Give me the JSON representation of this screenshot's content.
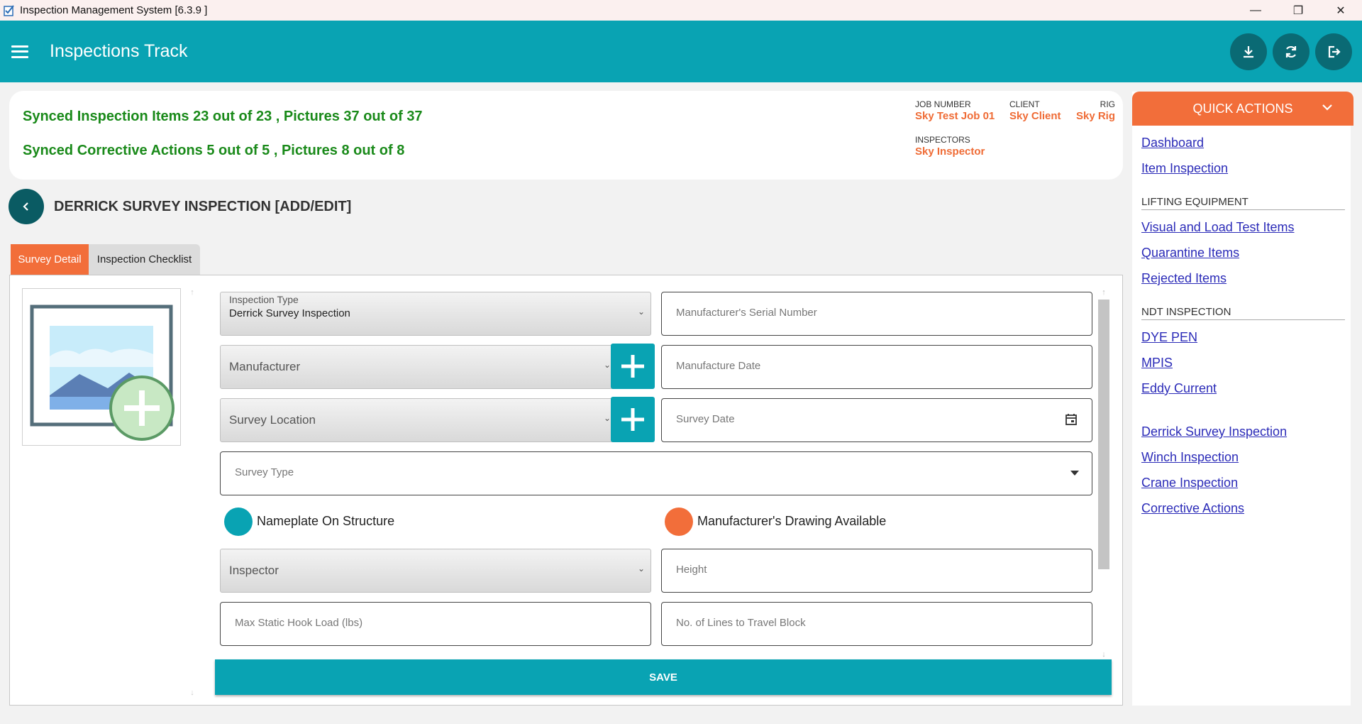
{
  "window": {
    "title": "Inspection Management System [6.3.9 ]"
  },
  "appbar": {
    "title": "Inspections Track"
  },
  "sync": {
    "items_prefix": "Synced Inspection Items",
    "items_done": "23",
    "items_total": "23",
    "items_pics_label": ", Pictures",
    "items_pics_done": "37",
    "items_pics_total": "37",
    "actions_prefix": "Synced Corrective Actions",
    "actions_done": "5",
    "actions_total": "5",
    "actions_pics_label": ", Pictures",
    "actions_pics_done": "8",
    "actions_pics_total": "8",
    "out_of": "out of"
  },
  "meta": {
    "job_label": "JOB NUMBER",
    "job_value": "Sky Test Job 01",
    "client_label": "CLIENT",
    "client_value": "Sky Client",
    "rig_label": "RIG",
    "rig_value": "Sky Rig",
    "inspectors_label": "INSPECTORS",
    "inspectors_value": "Sky Inspector"
  },
  "page": {
    "heading": "DERRICK SURVEY INSPECTION [ADD/EDIT]"
  },
  "tabs": [
    {
      "label": "Survey Detail",
      "active": true
    },
    {
      "label": "Inspection Checklist",
      "active": false
    }
  ],
  "form": {
    "inspection_type_label": "Inspection Type",
    "inspection_type_value": "Derrick Survey Inspection",
    "serial_placeholder": "Manufacturer's Serial Number",
    "manufacturer_label": "Manufacturer",
    "manufacture_date_placeholder": "Manufacture Date",
    "survey_location_label": "Survey Location",
    "survey_date_placeholder": "Survey Date",
    "survey_type_placeholder": "Survey Type",
    "nameplate_label": "Nameplate On Structure",
    "drawing_label": "Manufacturer's Drawing Available",
    "inspector_label": "Inspector",
    "height_placeholder": "Height",
    "hook_load_placeholder": "Max Static Hook Load (lbs)",
    "lines_placeholder": "No. of Lines to Travel Block",
    "save_label": "SAVE"
  },
  "quick_actions": {
    "title": "QUICK ACTIONS",
    "links_top": [
      "Dashboard",
      "Item Inspection"
    ],
    "lifting_title": "LIFTING EQUIPMENT",
    "lifting_links": [
      "Visual and Load Test Items",
      "Quarantine Items",
      "Rejected Items"
    ],
    "ndt_title": "NDT INSPECTION",
    "ndt_links": [
      "DYE PEN",
      "MPIS",
      "Eddy Current"
    ],
    "other_links": [
      "Derrick Survey Inspection",
      "Winch Inspection",
      "Crane Inspection",
      "Corrective Actions"
    ]
  },
  "colors": {
    "teal": "#09a3b3",
    "orange": "#f26e3a",
    "green": "#1a8a1a",
    "link": "#2b2bb8"
  }
}
